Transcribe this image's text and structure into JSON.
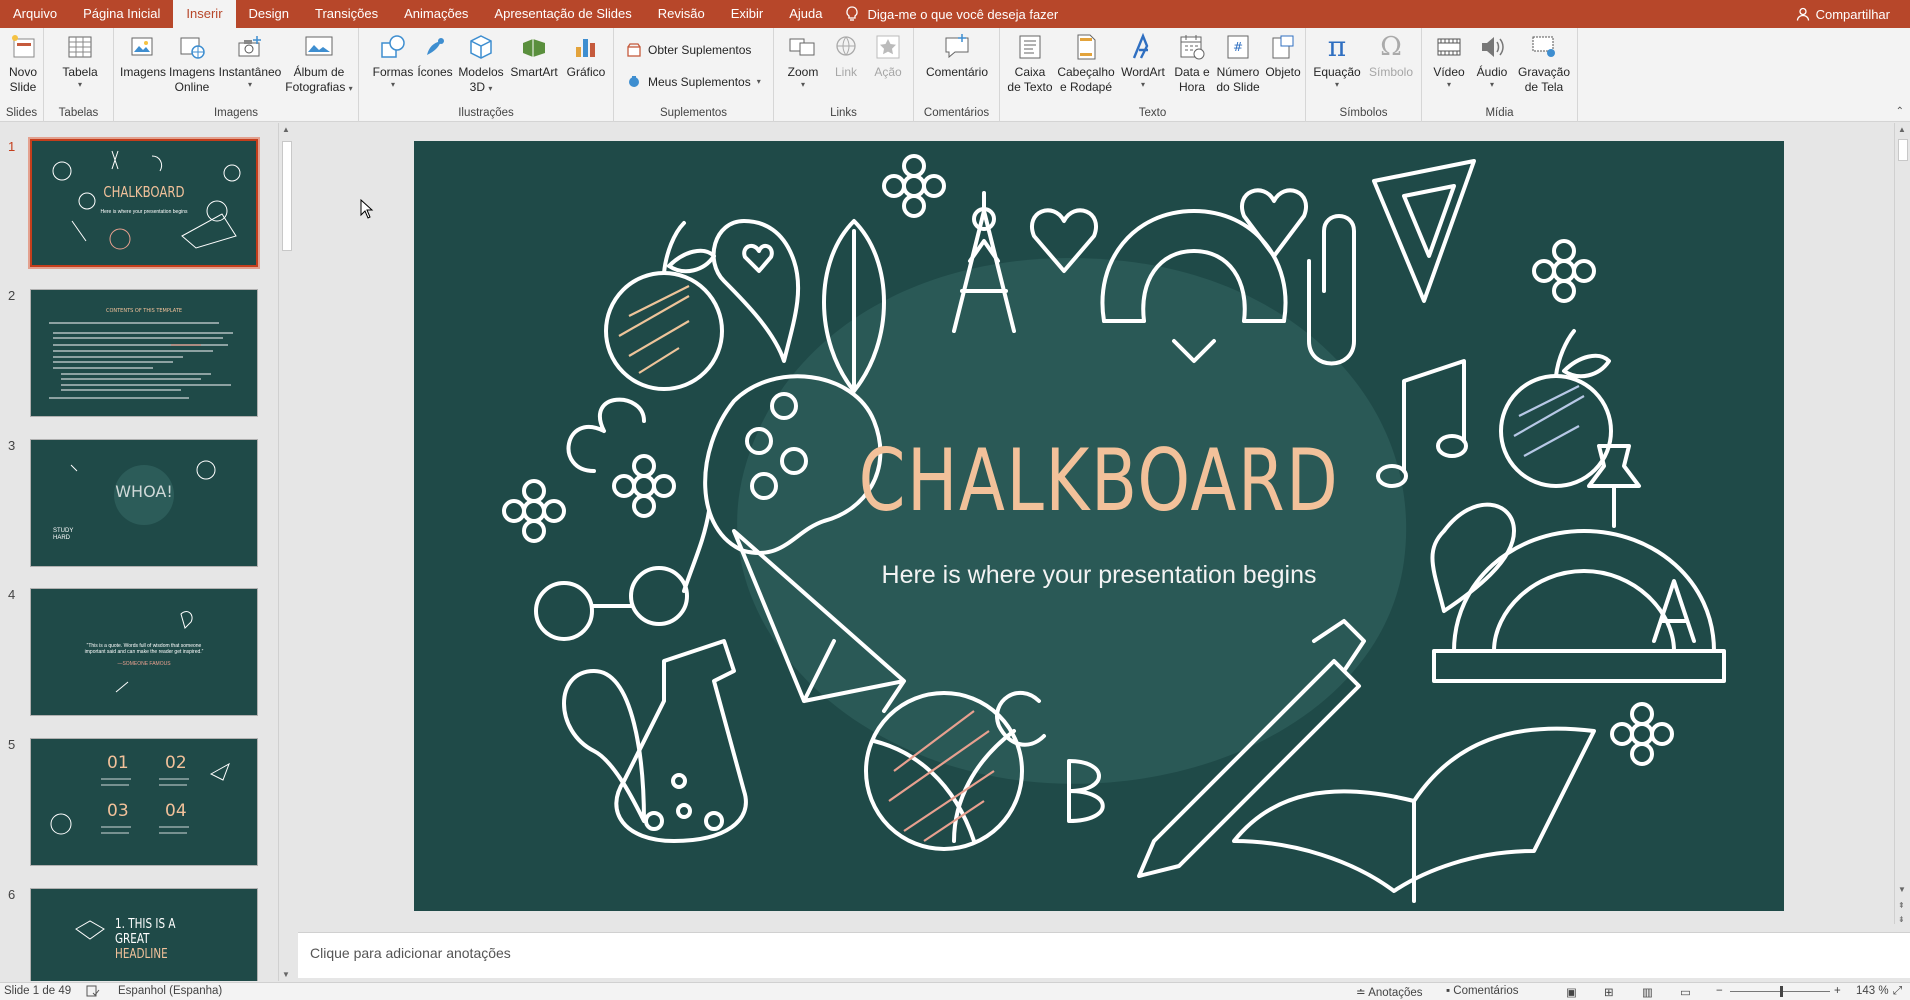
{
  "menu": {
    "tabs": [
      "Arquivo",
      "Página Inicial",
      "Inserir",
      "Design",
      "Transições",
      "Animações",
      "Apresentação de Slides",
      "Revisão",
      "Exibir",
      "Ajuda"
    ],
    "active_tab": "Inserir",
    "tell_me": "Diga-me o que você deseja fazer",
    "share": "Compartilhar"
  },
  "ribbon": {
    "slides": {
      "label": "Slides",
      "novo_slide_1": "Novo",
      "novo_slide_2": "Slide"
    },
    "tabelas": {
      "label": "Tabelas",
      "tabela": "Tabela"
    },
    "imagens": {
      "label": "Imagens",
      "imagens": "Imagens",
      "online_1": "Imagens",
      "online_2": "Online",
      "instantaneo": "Instantâneo",
      "album_1": "Álbum de",
      "album_2": "Fotografias"
    },
    "ilustracoes": {
      "label": "Ilustrações",
      "formas": "Formas",
      "icones": "Ícones",
      "modelos_1": "Modelos",
      "modelos_2": "3D",
      "smartart": "SmartArt",
      "grafico": "Gráfico"
    },
    "suplementos": {
      "label": "Suplementos",
      "obter": "Obter Suplementos",
      "meus": "Meus Suplementos"
    },
    "links": {
      "label": "Links",
      "zoom": "Zoom",
      "link": "Link",
      "acao": "Ação"
    },
    "comentarios": {
      "label": "Comentários",
      "comentario": "Comentário"
    },
    "texto": {
      "label": "Texto",
      "caixa_1": "Caixa",
      "caixa_2": "de Texto",
      "cabecalho_1": "Cabeçalho",
      "cabecalho_2": "e Rodapé",
      "wordart": "WordArt",
      "data_1": "Data e",
      "data_2": "Hora",
      "numero_1": "Número",
      "numero_2": "do Slide",
      "objeto": "Objeto"
    },
    "simbolos": {
      "label": "Símbolos",
      "equacao": "Equação",
      "simbolo": "Símbolo"
    },
    "midia": {
      "label": "Mídia",
      "video": "Vídeo",
      "audio": "Áudio",
      "gravacao_1": "Gravação",
      "gravacao_2": "de Tela"
    }
  },
  "slides_panel": {
    "numbers": [
      "1",
      "2",
      "3",
      "4",
      "5",
      "6"
    ],
    "thumb1_title": "CHALKBOARD",
    "thumb1_sub": "Here is where your presentation begins",
    "thumb2_title": "CONTENTS OF THIS TEMPLATE",
    "thumb3_title": "WHOA!",
    "thumb3_side": "STUDY HARD",
    "thumb4_quote": "“This is a quote. Words full of wisdom that someone important said and can make the reader get inspired.”",
    "thumb4_author": "—SOMEONE FAMOUS",
    "thumb5_n1": "01",
    "thumb5_n2": "02",
    "thumb5_n3": "03",
    "thumb5_n4": "04",
    "thumb6_l1": "1. THIS IS A",
    "thumb6_l2": "GREAT",
    "thumb6_l3": "HEADLINE"
  },
  "slide": {
    "title": "CHALKBOARD",
    "subtitle": "Here is where your presentation begins"
  },
  "notes": {
    "placeholder": "Clique para adicionar anotações"
  },
  "status": {
    "slide_count": "Slide 1 de 49",
    "language": "Espanhol (Espanha)",
    "notes": "Anotações",
    "comments": "Comentários",
    "zoom": "143 %"
  },
  "colors": {
    "accent": "#b7472a",
    "slide_bg": "#1f4a48",
    "title": "#f2c19a"
  }
}
